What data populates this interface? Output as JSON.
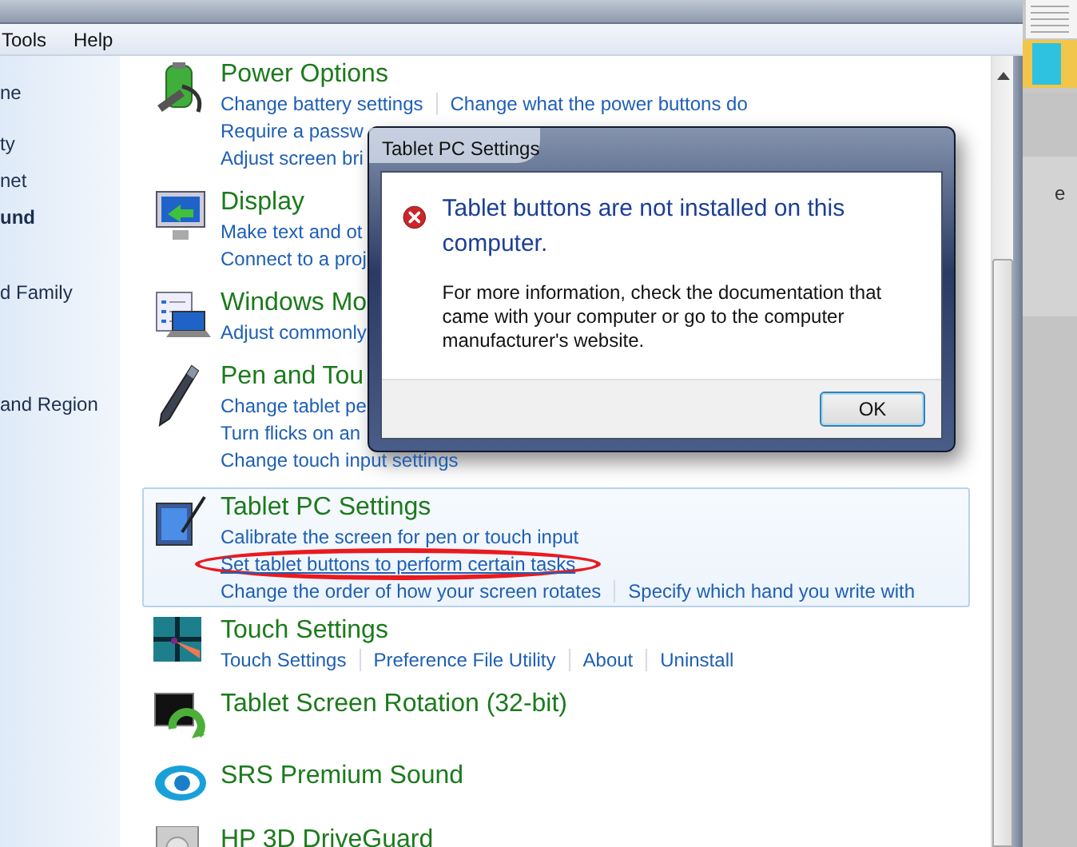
{
  "menu": [
    "Tools",
    "Help"
  ],
  "sidebar": {
    "items": [
      {
        "label": "ne",
        "selected": false
      },
      {
        "label": "ty",
        "selected": false
      },
      {
        "label": "net",
        "selected": false
      },
      {
        "label": "und",
        "selected": true
      },
      {
        "label": "d Family",
        "selected": false
      },
      {
        "label": "and Region",
        "selected": false
      }
    ]
  },
  "items": [
    {
      "title": "Power Options",
      "selected": false,
      "rows": [
        [
          {
            "text": "Change battery settings",
            "hovered": false
          },
          {
            "text": "Change what the power buttons do",
            "hovered": false
          }
        ],
        [
          {
            "text": "Require a passw",
            "hovered": false
          }
        ],
        [
          {
            "text": "Adjust screen bri",
            "hovered": false
          }
        ]
      ]
    },
    {
      "title": "Display",
      "selected": false,
      "rows": [
        [
          {
            "text": "Make text and ot",
            "hovered": false
          }
        ],
        [
          {
            "text": "Connect to a proj",
            "hovered": false
          }
        ]
      ]
    },
    {
      "title": "Windows Mo",
      "selected": false,
      "rows": [
        [
          {
            "text": "Adjust commonly",
            "hovered": false
          }
        ]
      ]
    },
    {
      "title": "Pen and Tou",
      "selected": false,
      "rows": [
        [
          {
            "text": "Change tablet pe",
            "hovered": false
          }
        ],
        [
          {
            "text": "Turn flicks on an",
            "hovered": false
          }
        ],
        [
          {
            "text": "Change touch input settings",
            "hovered": false
          }
        ]
      ]
    },
    {
      "title": "Tablet PC Settings",
      "selected": true,
      "rows": [
        [
          {
            "text": "Calibrate the screen for pen or touch input",
            "hovered": false
          }
        ],
        [
          {
            "text": "Set tablet buttons to perform certain tasks",
            "hovered": true
          }
        ],
        [
          {
            "text": "Change the order of how your screen rotates",
            "hovered": false
          },
          {
            "text": "Specify which hand you write with",
            "hovered": false
          }
        ]
      ]
    },
    {
      "title": "Touch Settings",
      "selected": false,
      "rows": [
        [
          {
            "text": "Touch Settings",
            "hovered": false
          },
          {
            "text": "Preference File Utility",
            "hovered": false
          },
          {
            "text": "About",
            "hovered": false
          },
          {
            "text": "Uninstall",
            "hovered": false
          }
        ]
      ]
    },
    {
      "title": "Tablet Screen Rotation (32-bit)",
      "selected": false
    },
    {
      "title": "SRS Premium Sound",
      "selected": false
    },
    {
      "title": "HP 3D DriveGuard",
      "selected": false
    }
  ],
  "dialog": {
    "title": "Tablet PC Settings",
    "heading": "Tablet buttons are not installed on this computer.",
    "message": "For more information, check the documentation that came with your computer or go to the computer manufacturer's website.",
    "button": "OK"
  },
  "desktop": {
    "label": "e"
  }
}
